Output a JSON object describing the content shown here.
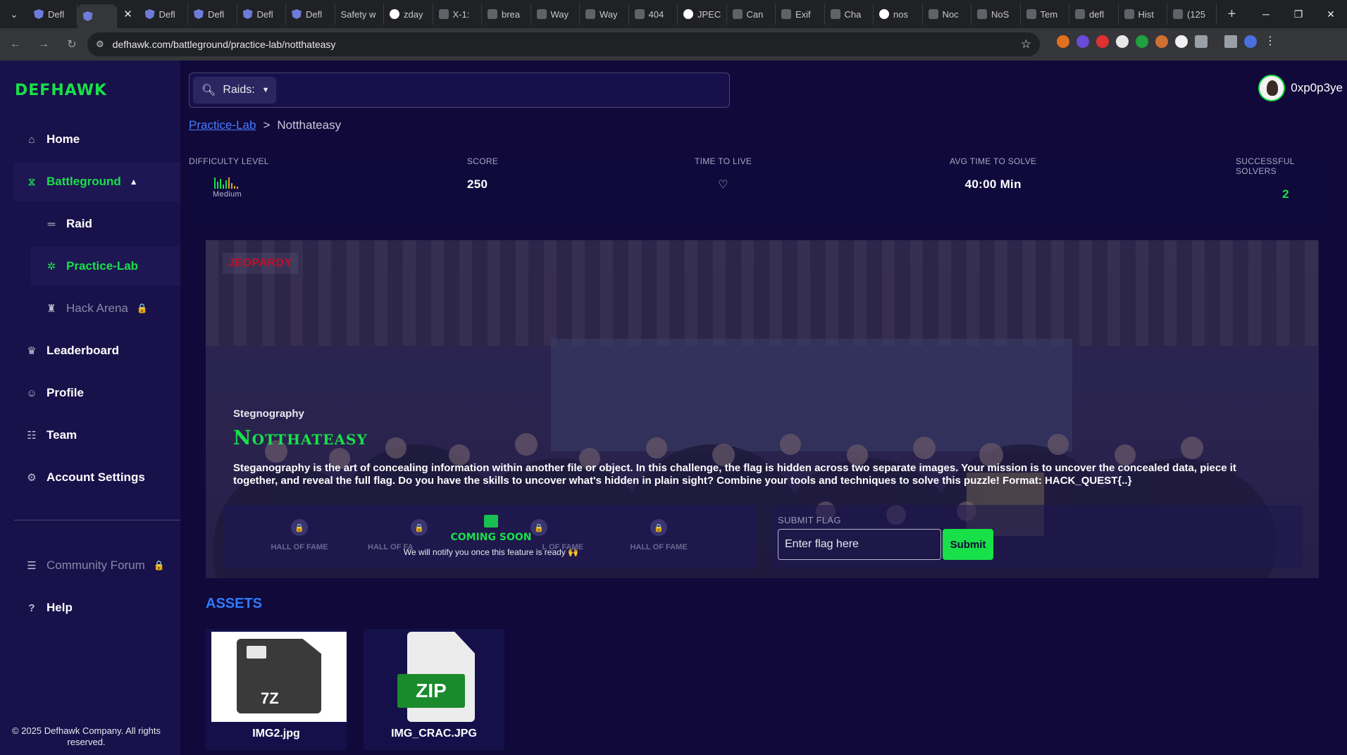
{
  "browser": {
    "tabs": [
      {
        "label": "Defl"
      },
      {
        "label": ""
      },
      {
        "label": "Defl"
      },
      {
        "label": "Defl"
      },
      {
        "label": "Defl"
      },
      {
        "label": "Defl"
      },
      {
        "label": "Safety w"
      },
      {
        "label": "zday"
      },
      {
        "label": "X-1:"
      },
      {
        "label": "brea"
      },
      {
        "label": "Way"
      },
      {
        "label": "Way"
      },
      {
        "label": "404"
      },
      {
        "label": "JPEC"
      },
      {
        "label": "Can"
      },
      {
        "label": "Exif"
      },
      {
        "label": "Cha"
      },
      {
        "label": "nos"
      },
      {
        "label": "Noc"
      },
      {
        "label": "NoS"
      },
      {
        "label": "Tem"
      },
      {
        "label": "defl"
      },
      {
        "label": "Hist"
      },
      {
        "label": "(125"
      }
    ],
    "url": "defhawk.com/battleground/practice-lab/notthateasy"
  },
  "app": {
    "logo": "DEFHAWK",
    "username": "0xp0p3ye",
    "search": {
      "dropdown_label": "Raids:",
      "placeholder": ""
    },
    "nav": {
      "home": "Home",
      "battleground": "Battleground",
      "raid": "Raid",
      "practice_lab": "Practice-Lab",
      "hack_arena": "Hack Arena",
      "leaderboard": "Leaderboard",
      "profile": "Profile",
      "team": "Team",
      "account_settings": "Account Settings",
      "community_forum": "Community Forum",
      "help": "Help"
    },
    "copyright": "© 2025 Defhawk Company. All rights reserved.",
    "breadcrumb": {
      "parent": "Practice-Lab",
      "separator": ">",
      "current": "Notthateasy"
    }
  },
  "stats": {
    "difficulty_label": "DIFFICULTY LEVEL",
    "difficulty_value": "Medium",
    "score_label": "SCORE",
    "score_value": "250",
    "ttl_label": "TIME TO LIVE",
    "avg_label": "AVG TIME TO SOLVE",
    "avg_value": "40:00 Min",
    "solvers_label": "SUCCESSFUL SOLVERS",
    "solvers_value": "2"
  },
  "challenge": {
    "tag": "JEOPARDY",
    "category": "Stegnography",
    "title": "Notthateasy",
    "description": "Steganography is the art of concealing information within another file or object. In this challenge, the flag is hidden across two separate images. Your mission is to uncover the concealed data, piece it together, and reveal the full flag. Do you have the skills to uncover what's hidden in plain sight? Combine your tools and techniques to solve this puzzle! Format: HACK_QUEST{..}",
    "hall_of_fame": [
      "HALL OF FAME",
      "HALL OF FA",
      "L OF FAME",
      "HALL OF FAME"
    ],
    "coming_soon": "COMING SOON",
    "notify_text": "We will notify you once this feature is ready 🙌",
    "submit_flag_label": "SUBMIT FLAG",
    "flag_placeholder": "Enter flag here",
    "submit_button": "Submit"
  },
  "assets": {
    "title": "ASSETS",
    "files": [
      {
        "name": "IMG2.jpg",
        "icon_text": "7Z"
      },
      {
        "name": "IMG_CRAC.JPG",
        "icon_text": "ZIP"
      }
    ]
  },
  "colors": {
    "accent_green": "#18e048",
    "link_blue": "#4a7cff",
    "bg": "#10093a",
    "sidebar": "#18114a"
  }
}
